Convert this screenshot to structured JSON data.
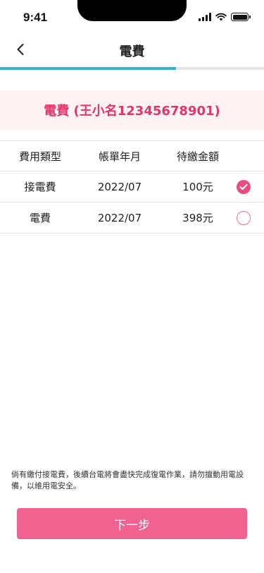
{
  "status_bar": {
    "time": "9:41"
  },
  "header": {
    "title": "電費",
    "progress_fraction": 0.667
  },
  "customer": {
    "title": "電費 (王小名12345678901)"
  },
  "table": {
    "columns": [
      "費用類型",
      "帳單年月",
      "待繳金額"
    ],
    "rows": [
      {
        "type": "接電費",
        "month": "2022/07",
        "amount": "100元",
        "selected": true
      },
      {
        "type": "電費",
        "month": "2022/07",
        "amount": "398元",
        "selected": false
      }
    ]
  },
  "notice": "倘有繳付接電費，後續台電將會盡快完成復電作業，請勿擅動用電設備，以維用電安全。",
  "next_button": {
    "label": "下一步"
  },
  "colors": {
    "accent": "#e5336b",
    "button": "#f06290",
    "progress": "#2fb6c9",
    "banner_bg": "#fdf3f5"
  }
}
